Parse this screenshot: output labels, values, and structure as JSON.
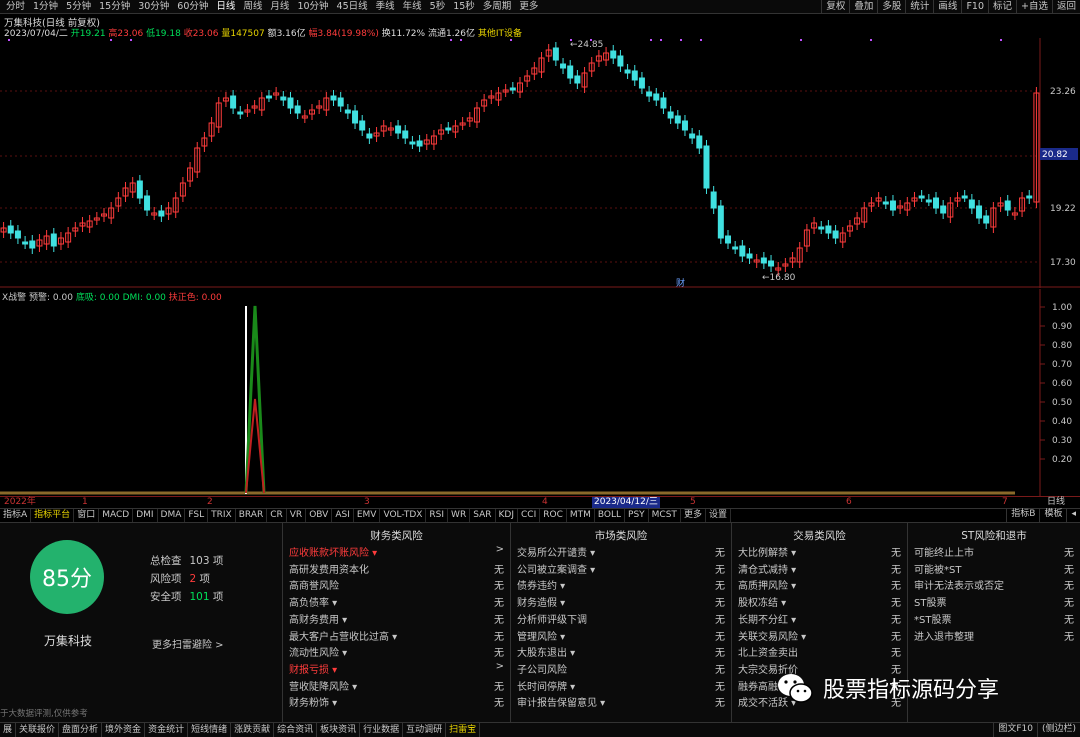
{
  "toolbar": {
    "periods": [
      "分时",
      "1分钟",
      "5分钟",
      "15分钟",
      "30分钟",
      "60分钟",
      "日线",
      "周线",
      "月线",
      "10分钟",
      "45日线",
      "季线",
      "年线",
      "5秒",
      "15秒",
      "多周期",
      "更多"
    ],
    "active_period": "日线",
    "right_buttons": [
      "复权",
      "叠加",
      "多股",
      "统计",
      "画线",
      "F10",
      "标记",
      "+自选",
      "返回"
    ]
  },
  "quote": {
    "title": "万集科技(日线 前复权)",
    "date": "2023/07/04/二",
    "open": "开19.21",
    "high": "高23.06",
    "low": "低19.18",
    "close": "收23.06",
    "volume": "量147507",
    "amount": "额3.16亿",
    "change": "幅3.84(19.98%)",
    "turnover": "换11.72%",
    "float": "流通1.26亿",
    "sector": "其他IT设备"
  },
  "main_chart": {
    "y_labels": [
      "23.26",
      "20.82",
      "19.22",
      "17.30"
    ],
    "current_price": "20.82",
    "high_marker": "24.85",
    "low_marker": "16.80",
    "event_label": "财"
  },
  "sub_chart": {
    "name": "X战警",
    "signal": "预警: 0.00",
    "low_suck": "底吸: 0.00",
    "dmi": "DMI: 0.00",
    "correction": "扶正色: 0.00",
    "y_labels": [
      "1.00",
      "0.90",
      "0.80",
      "0.70",
      "0.60",
      "0.50",
      "0.40",
      "0.30",
      "0.20"
    ]
  },
  "x_axis": {
    "labels": [
      "2022年",
      "1",
      "2",
      "3",
      "4",
      "5",
      "6",
      "7"
    ],
    "cursor_date": "2023/04/12/三",
    "right_label": "日线"
  },
  "indicator_tabs": [
    "指标A",
    "指标平台",
    "窗口",
    "MACD",
    "DMI",
    "DMA",
    "FSL",
    "TRIX",
    "BRAR",
    "CR",
    "VR",
    "OBV",
    "ASI",
    "EMV",
    "VOL-TDX",
    "RSI",
    "WR",
    "SAR",
    "KDJ",
    "CCI",
    "ROC",
    "MTM",
    "BOLL",
    "PSY",
    "MCST",
    "更多",
    "设置"
  ],
  "indicator_tabs_right": [
    "指标B",
    "模板",
    "◂"
  ],
  "risk": {
    "score": "85分",
    "company": "万集科技",
    "total_label": "总检查",
    "total_value": "103",
    "risk_label": "风险项",
    "risk_value": "2",
    "safe_label": "安全项",
    "safe_value": "101",
    "unit": "项",
    "more": "更多扫雷避险 >",
    "disclaimer": "于大数据评测,仅供参考",
    "columns": [
      {
        "title": "财务类风险",
        "items": [
          {
            "label": "应收账款坏账风险 ▾",
            "value": ">",
            "risk": true
          },
          {
            "label": "高研发费用资本化",
            "value": "无"
          },
          {
            "label": "高商誉风险",
            "value": "无"
          },
          {
            "label": "高负债率 ▾",
            "value": "无"
          },
          {
            "label": "高财务费用 ▾",
            "value": "无"
          },
          {
            "label": "最大客户占营收比过高 ▾",
            "value": "无"
          },
          {
            "label": "流动性风险 ▾",
            "value": "无"
          },
          {
            "label": "财报亏损 ▾",
            "value": ">",
            "risk": true
          },
          {
            "label": "营收陡降风险 ▾",
            "value": "无"
          },
          {
            "label": "财务粉饰 ▾",
            "value": "无"
          }
        ]
      },
      {
        "title": "市场类风险",
        "items": [
          {
            "label": "交易所公开谴责 ▾",
            "value": "无"
          },
          {
            "label": "公司被立案调查 ▾",
            "value": "无"
          },
          {
            "label": "债券违约 ▾",
            "value": "无"
          },
          {
            "label": "财务造假 ▾",
            "value": "无"
          },
          {
            "label": "分析师评级下调",
            "value": "无"
          },
          {
            "label": "管理风险 ▾",
            "value": "无"
          },
          {
            "label": "大股东退出 ▾",
            "value": "无"
          },
          {
            "label": "子公司风险",
            "value": "无"
          },
          {
            "label": "长时间停牌 ▾",
            "value": "无"
          },
          {
            "label": "审计报告保留意见 ▾",
            "value": "无"
          }
        ]
      },
      {
        "title": "交易类风险",
        "items": [
          {
            "label": "大比例解禁 ▾",
            "value": "无"
          },
          {
            "label": "清仓式减持 ▾",
            "value": "无"
          },
          {
            "label": "高质押风险 ▾",
            "value": "无"
          },
          {
            "label": "股权冻结 ▾",
            "value": "无"
          },
          {
            "label": "长期不分红 ▾",
            "value": "无"
          },
          {
            "label": "关联交易风险 ▾",
            "value": "无"
          },
          {
            "label": "北上资金卖出",
            "value": "无"
          },
          {
            "label": "大宗交易折价",
            "value": "无"
          },
          {
            "label": "融券高融",
            "value": "无"
          },
          {
            "label": "成交不活跃 ▾",
            "value": "无"
          }
        ]
      },
      {
        "title": "ST风险和退市",
        "items": [
          {
            "label": "可能终止上市",
            "value": "无"
          },
          {
            "label": "可能被*ST",
            "value": "无"
          },
          {
            "label": "审计无法表示或否定",
            "value": "无"
          },
          {
            "label": "ST股票",
            "value": "无"
          },
          {
            "label": "*ST股票",
            "value": "无"
          },
          {
            "label": "进入退市整理",
            "value": "无"
          }
        ]
      }
    ]
  },
  "status_tabs": [
    "展",
    "关联报价",
    "盘面分析",
    "境外资金",
    "资金统计",
    "短线情绪",
    "涨跌贡献",
    "综合资讯",
    "板块资讯",
    "行业数据",
    "互动调研",
    "扫雷宝"
  ],
  "status_active": "扫雷宝",
  "status_right": [
    "图文F10",
    "(侧边栏)"
  ],
  "watermark": "股票指标源码分享",
  "colors": {
    "up": "#ff3c3c",
    "down": "#40e0e0",
    "grid": "#7a1a1a",
    "score": "#23b26d"
  }
}
